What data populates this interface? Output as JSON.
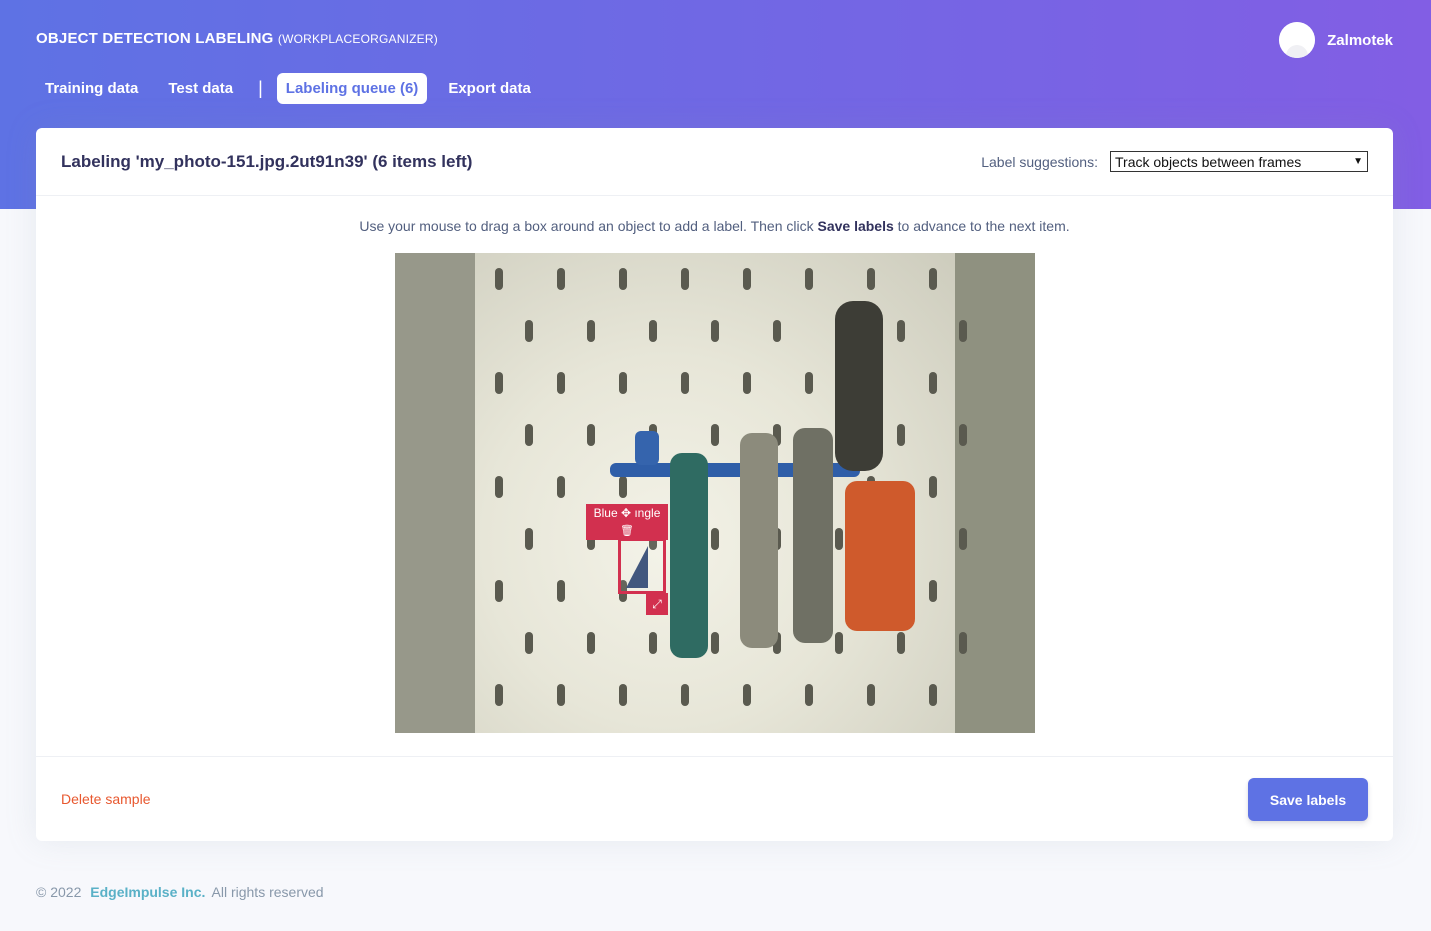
{
  "header": {
    "title": "OBJECT DETECTION LABELING",
    "project": "(WORKPLACEORGANIZER)",
    "user_name": "Zalmotek",
    "tabs": [
      {
        "label": "Training data",
        "active": false
      },
      {
        "label": "Test data",
        "active": false
      },
      {
        "label": "Labeling queue (6)",
        "active": true
      },
      {
        "label": "Export data",
        "active": false
      }
    ],
    "separator": "|"
  },
  "card": {
    "title": "Labeling 'my_photo-151.jpg.2ut91n39' (6 items left)",
    "suggestions_label": "Label suggestions:",
    "suggestions_value": "Track objects between frames",
    "instruction_pre": "Use your mouse to drag a box around an object to add a label. Then click",
    "instruction_bold": "Save labels",
    "instruction_post": "to advance to the next item.",
    "bbox_label": "Blue ✥ ıngle",
    "delete_label": "Delete sample",
    "save_label": "Save labels"
  },
  "footer": {
    "copyright": "© 2022",
    "company": "EdgeImpulse Inc.",
    "rights": "All rights reserved"
  },
  "colors": {
    "accent": "#5e72e4",
    "bbox": "#d2304f",
    "delete": "#e8582f"
  },
  "icons": [
    "user-avatar-icon",
    "move-icon",
    "trash-icon",
    "resize-icon",
    "chevron-down-icon"
  ]
}
